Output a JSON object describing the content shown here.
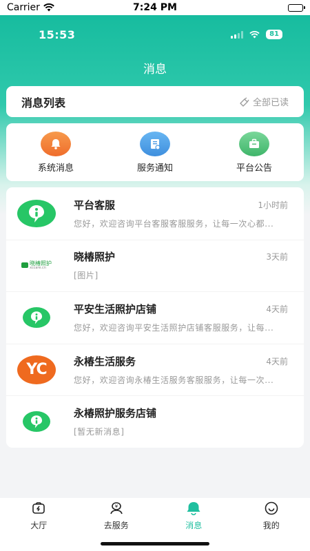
{
  "system_bar": {
    "carrier": "Carrier",
    "time": "7:24 PM"
  },
  "app_status": {
    "time": "15:53",
    "battery": "81"
  },
  "header": {
    "title": "消息"
  },
  "message_list": {
    "title": "消息列表",
    "mark_all_read": "全部已读"
  },
  "categories": [
    {
      "label": "系统消息",
      "icon": "bell-icon",
      "color": "#f0752f"
    },
    {
      "label": "服务通知",
      "icon": "clipboard-icon",
      "color": "#4a9be4"
    },
    {
      "label": "平台公告",
      "icon": "briefcase-icon",
      "color": "#4cbb72"
    }
  ],
  "conversations": [
    {
      "name": "平台客服",
      "time": "1小时前",
      "preview": "您好，欢迎咨询平台客服客服服务，让每一次心都...",
      "avatar": "chat-bubble-logo"
    },
    {
      "name": "晓椿照护",
      "time": "3天前",
      "preview": "[图片]",
      "avatar": "xiaochun-logo",
      "logo_text": "晓椿照护",
      "logo_sub": "xccare.cn"
    },
    {
      "name": "平安生活照护店铺",
      "time": "4天前",
      "preview": "您好，欢迎咨询平安生活照护店铺客服服务，让每...",
      "avatar": "chat-bubble-logo"
    },
    {
      "name": "永椿生活服务",
      "time": "4天前",
      "preview": "您好，欢迎咨询永椿生活服务客服服务，让每一次...",
      "avatar": "yc-logo",
      "logo_text": "YC"
    },
    {
      "name": "永椿照护服务店铺",
      "time": "",
      "preview": "[暂无新消息]",
      "avatar": "chat-bubble-logo"
    }
  ],
  "tabbar": [
    {
      "label": "大厅",
      "icon": "home-icon",
      "active": false
    },
    {
      "label": "去服务",
      "icon": "service-icon",
      "active": false
    },
    {
      "label": "消息",
      "icon": "message-icon",
      "active": true
    },
    {
      "label": "我的",
      "icon": "profile-icon",
      "active": false
    }
  ],
  "colors": {
    "accent": "#1fbf9f",
    "chat_green": "#27c666",
    "yc_orange": "#ef6a1f"
  }
}
